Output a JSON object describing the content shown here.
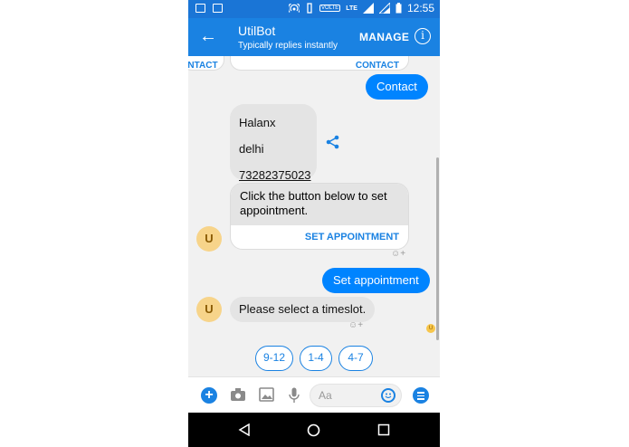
{
  "status_bar": {
    "network_badge": "VOLTE",
    "lte": "LTE",
    "time": "12:55"
  },
  "header": {
    "bot_name": "UtilBot",
    "subtitle": "Typically replies instantly",
    "manage_label": "MANAGE"
  },
  "chat": {
    "cut_off_card_left": "NTACT",
    "cut_off_card_right": "CONTACT",
    "out_contact": "Contact",
    "contact_card": {
      "name": "Halanx",
      "city": "delhi",
      "phone": "73282375023"
    },
    "appointment_card": {
      "text": "Click the button below to set appointment.",
      "button": "SET APPOINTMENT"
    },
    "bot_avatar_initial": "U",
    "out_set_appointment": "Set appointment",
    "in_timeslot": "Please select a timeslot.",
    "read_receipt_initial": "U",
    "quick_replies": [
      "9-12",
      "1-4",
      "4-7"
    ]
  },
  "composer": {
    "placeholder": "Aa"
  },
  "colors": {
    "primary": "#1a82e2",
    "outgoing_bubble": "#0084ff",
    "incoming_bubble": "#e4e4e4",
    "avatar": "#f7d48a"
  },
  "icons": [
    "back-arrow-icon",
    "info-icon",
    "share-icon",
    "camera-icon",
    "image-icon",
    "microphone-icon",
    "emoji-icon",
    "menu-icon",
    "plus-icon"
  ]
}
